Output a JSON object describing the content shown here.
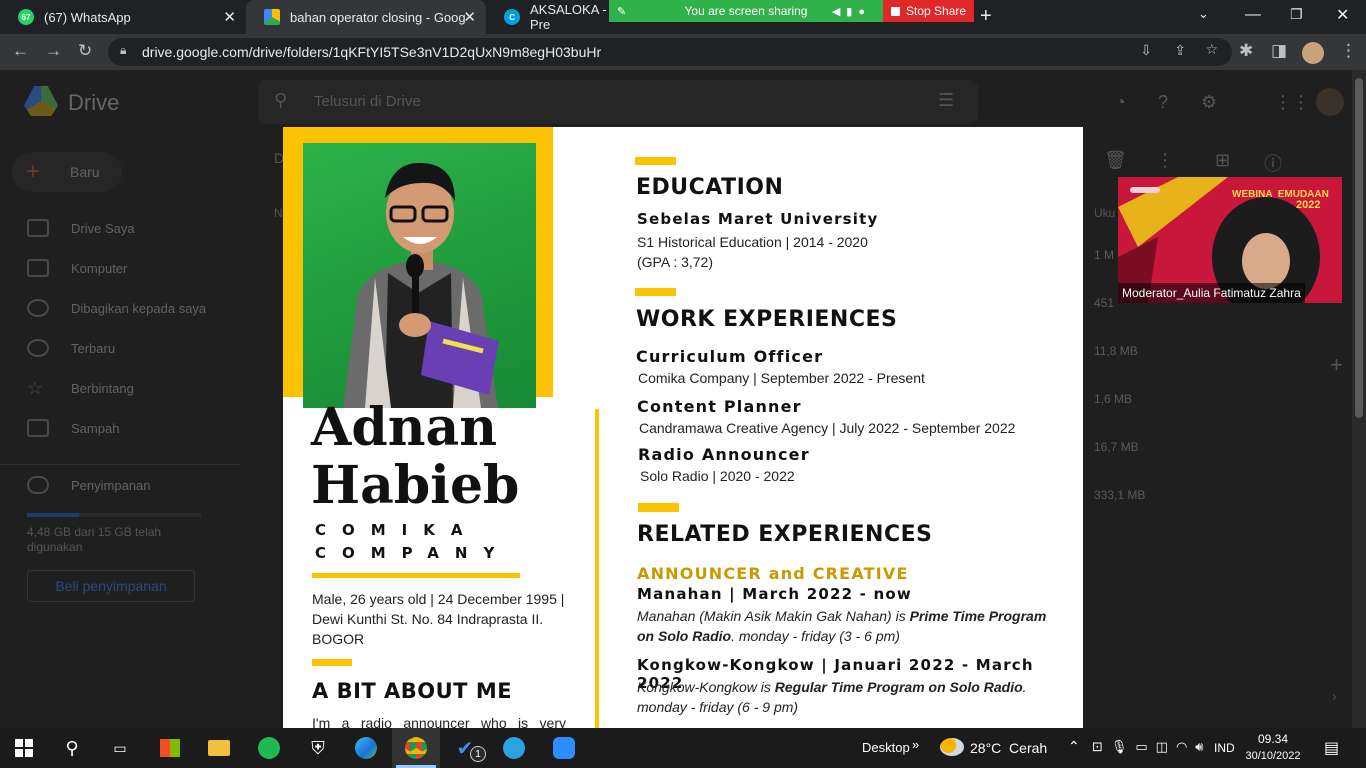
{
  "browser": {
    "tabs": [
      {
        "label": "(67) WhatsApp",
        "badge": "67"
      },
      {
        "label": "bahan operator closing - Google"
      },
      {
        "label": "AKSALOKA - Pre"
      }
    ],
    "url": "drive.google.com/drive/folders/1qKFtYI5TSe3nV1D2qUxN9m8egH03buHr"
  },
  "share": {
    "status": "You are screen sharing",
    "stop_label": "Stop Share"
  },
  "drive": {
    "app_name": "Drive",
    "search_placeholder": "Telusuri di Drive",
    "new_label": "Baru",
    "nav": [
      "Drive Saya",
      "Komputer",
      "Dibagikan kepada saya",
      "Terbaru",
      "Berbintang",
      "Sampah"
    ],
    "storage_label": "Penyimpanan",
    "storage_text": "4,48 GB dari 15 GB telah digunakan",
    "storage_used_fraction": 0.3,
    "buy_storage": "Beli penyimpanan",
    "col_partial_left": "D",
    "col_partial_n": "N",
    "col_size": "Uku",
    "sizes": [
      "1 M",
      "451",
      "11,8 MB",
      "1,6 MB",
      "16,7 MB",
      "333,1 MB"
    ]
  },
  "cv": {
    "first_name": "Adnan",
    "last_name": "Habieb",
    "company_line1": "COMIKA",
    "company_line2": "COMPANY",
    "bio": "Male, 26 years old | 24 December 1995 | Dewi Kunthi St. No. 84 Indraprasta II. BOGOR",
    "about_title": "A BIT ABOUT ME",
    "about_text": "I'm a radio announcer who is very",
    "education_title": "EDUCATION",
    "education_school": "Sebelas Maret University",
    "education_degree": "S1 Historical Education | 2014 - 2020",
    "education_gpa": "(GPA : 3,72)",
    "work_title": "WORK EXPERIENCES",
    "jobs": [
      {
        "role": "Curriculum Officer",
        "detail": "Comika Company | September 2022 - Present"
      },
      {
        "role": "Content Planner",
        "detail": "Candramawa Creative Agency | July 2022 - September 2022"
      },
      {
        "role": "Radio Announcer",
        "detail": "Solo Radio | 2020 - 2022"
      }
    ],
    "related_title": "RELATED EXPERIENCES",
    "related_category": "ANNOUNCER and CREATIVE",
    "programs": [
      {
        "name": "Manahan | March 2022 - now",
        "desc_plain": "Manahan (Makin Asik Makin Gak Nahan) is ",
        "desc_bold": "Prime Time Program on Solo Radio",
        "desc_tail": ". monday - friday (3 - 6 pm)"
      },
      {
        "name": "Kongkow-Kongkow | Januari 2022 - March 2022",
        "desc_plain": "Kongkow-Kongkow is ",
        "desc_bold": "Regular Time Program on Solo Radio",
        "desc_tail": ". monday - friday (6 - 9 pm)"
      }
    ]
  },
  "video": {
    "participant": "Moderator_Aulia Fatimatuz Zahra",
    "banner_text": "WEBINA  EMUDAAN",
    "banner_year": "2022"
  },
  "taskbar": {
    "desktop_label": "Desktop",
    "weather": "28°C  Cerah",
    "lang": "IND",
    "time": "09.34",
    "date": "30/10/2022",
    "todo_badge": "1"
  },
  "colors": {
    "accent": "#fbc302",
    "green_screen": "#22a33f",
    "share_green": "#2fb24a",
    "stop_red": "#e02828"
  }
}
